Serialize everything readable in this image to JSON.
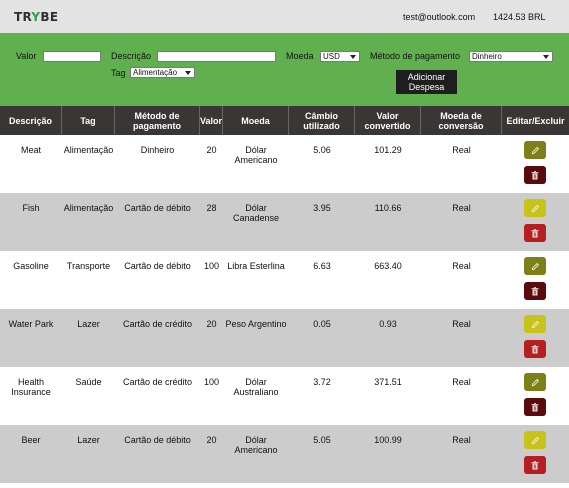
{
  "header": {
    "logo_prefix": "TR",
    "logo_y": "Y",
    "logo_suffix": "BE",
    "email": "test@outlook.com",
    "total": "1424.53 BRL"
  },
  "form": {
    "valor_label": "Valor",
    "valor_value": "",
    "descricao_label": "Descrição",
    "descricao_value": "",
    "moeda_label": "Moeda",
    "moeda_selected": "USD",
    "metodo_label": "Método de pagamento",
    "metodo_selected": "Dinheiro",
    "tag_label": "Tag",
    "tag_selected": "Alimentação",
    "add_button_line1": "Adicionar",
    "add_button_line2": "Despesa"
  },
  "table": {
    "headers": {
      "descricao": "Descrição",
      "tag": "Tag",
      "metodo_1": "Método de",
      "metodo_2": "pagamento",
      "valor": "Valor",
      "moeda": "Moeda",
      "cambio_1": "Câmbio",
      "cambio_2": "utilizado",
      "convertido_1": "Valor",
      "convertido_2": "convertido",
      "conversao_1": "Moeda de",
      "conversao_2": "conversão",
      "editar": "Editar/Excluir"
    },
    "rows": [
      {
        "descricao_1": "Meat",
        "descricao_2": "",
        "tag": "Alimentação",
        "metodo": "Dinheiro",
        "valor": "20",
        "moeda_1": "Dólar",
        "moeda_2": "Americano",
        "cambio": "5.06",
        "convertido": "101.29",
        "conversao": "Real"
      },
      {
        "descricao_1": "Fish",
        "descricao_2": "",
        "tag": "Alimentação",
        "metodo": "Cartão de débito",
        "valor": "28",
        "moeda_1": "Dólar",
        "moeda_2": "Canadense",
        "cambio": "3.95",
        "convertido": "110.66",
        "conversao": "Real"
      },
      {
        "descricao_1": "Gasoline",
        "descricao_2": "",
        "tag": "Transporte",
        "metodo": "Cartão de débito",
        "valor": "100",
        "moeda_1": "Libra Esterlina",
        "moeda_2": "",
        "cambio": "6.63",
        "convertido": "663.40",
        "conversao": "Real"
      },
      {
        "descricao_1": "Water Park",
        "descricao_2": "",
        "tag": "Lazer",
        "metodo": "Cartão de crédito",
        "valor": "20",
        "moeda_1": "Peso Argentino",
        "moeda_2": "",
        "cambio": "0.05",
        "convertido": "0.93",
        "conversao": "Real"
      },
      {
        "descricao_1": "Health",
        "descricao_2": "Insurance",
        "tag": "Saúde",
        "metodo": "Cartão de crédito",
        "valor": "100",
        "moeda_1": "Dólar",
        "moeda_2": "Australiano",
        "cambio": "3.72",
        "convertido": "371.51",
        "conversao": "Real"
      },
      {
        "descricao_1": "Beer",
        "descricao_2": "",
        "tag": "Lazer",
        "metodo": "Cartão de débito",
        "valor": "20",
        "moeda_1": "Dólar",
        "moeda_2": "Americano",
        "cambio": "5.05",
        "convertido": "100.99",
        "conversao": "Real"
      }
    ]
  },
  "icons": {
    "edit": "pencil-icon",
    "delete": "trash-icon"
  },
  "colors": {
    "header_bg": "#e3e3e3",
    "form_bg": "#61b04f",
    "table_header_bg": "#3a3636",
    "row_alt_bg": "#cccccc",
    "edit_button": "#7d7f18",
    "edit_button_alt": "#c8c318",
    "delete_button": "#5a0c0c",
    "delete_button_alt": "#b51f1f",
    "brand_accent": "#2e9c57"
  }
}
